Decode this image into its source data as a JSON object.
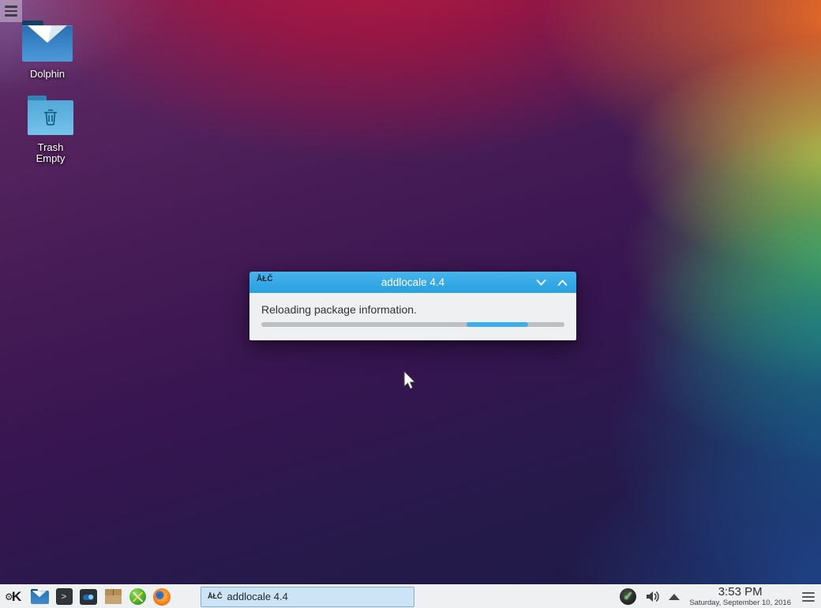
{
  "colors": {
    "accent_blue": "#3daee9",
    "titlebar_top": "#4ab4ec",
    "titlebar_bottom": "#29a1e1",
    "panel_bg": "#eef0f1",
    "task_button_bg": "#cde4f7",
    "task_button_border": "#7fb0dd",
    "progress_track": "#bdc0c2",
    "progress_fill": "#3daee9"
  },
  "desktop": {
    "icons": [
      {
        "label": "Dolphin"
      },
      {
        "label": "Trash",
        "sublabel": "Empty"
      }
    ]
  },
  "dialog": {
    "icon_text": "ÅŁČ",
    "title": "addlocale 4.4",
    "message": "Reloading package information.",
    "progress": {
      "left": "67.8%",
      "width": "20.2%"
    }
  },
  "taskbar": {
    "launchers": [
      {
        "name": "KDE menu"
      },
      {
        "name": "File manager"
      },
      {
        "name": "Terminal"
      },
      {
        "name": "Settings"
      },
      {
        "name": "Packages"
      },
      {
        "name": "System tools"
      },
      {
        "name": "Firefox"
      }
    ],
    "task_button": {
      "icon_text": "ÅŁČ",
      "label": "addlocale 4.4"
    },
    "tray": {
      "update_check": "✓"
    },
    "clock": {
      "time": "3:53 PM",
      "date": "Saturday, September 10, 2016"
    }
  }
}
